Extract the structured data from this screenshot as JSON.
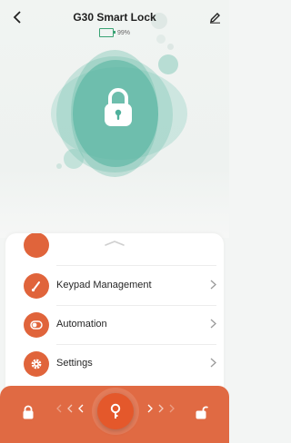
{
  "header": {
    "title": "G30 Smart Lock",
    "battery_text": "99%",
    "back_icon": "chevron-left-icon",
    "edit_icon": "pencil-icon"
  },
  "hero": {
    "lock_state": "locked",
    "accent": "#4fb09c"
  },
  "menu": {
    "items": [
      {
        "label": "",
        "icon": "partial-item-icon"
      },
      {
        "label": "Keypad Management",
        "icon": "keypad-pen-icon"
      },
      {
        "label": "Automation",
        "icon": "toggle-icon"
      },
      {
        "label": "Settings",
        "icon": "gear-icon"
      }
    ]
  },
  "slider": {
    "left_icon": "lock-closed-icon",
    "right_icon": "lock-open-icon",
    "knob_icon": "key-icon",
    "color": "#e06a43"
  }
}
